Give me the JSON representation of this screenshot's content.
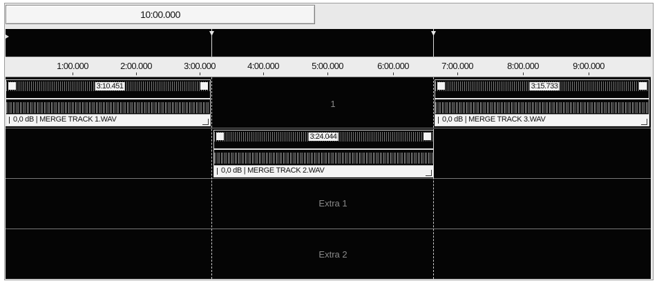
{
  "project": {
    "length": "10:00.000"
  },
  "ruler": {
    "ticks": [
      "1:00.000",
      "2:00.000",
      "3:00.000",
      "4:00.000",
      "5:00.000",
      "6:00.000",
      "7:00.000",
      "8:00.000",
      "9:00.000"
    ]
  },
  "tracks": [
    {
      "name": "1"
    },
    {
      "name": ""
    },
    {
      "name": "Extra 1"
    },
    {
      "name": "Extra 2"
    }
  ],
  "clips": [
    {
      "track": 1,
      "length": "3:10.451",
      "gain_label": "0,0 dB | MERGE TRACK 1.WAV"
    },
    {
      "track": 2,
      "length": "3:24.044",
      "gain_label": "0,0 dB | MERGE TRACK 2.WAV"
    },
    {
      "track": 1,
      "length": "3:15.733",
      "gain_label": "0,0 dB | MERGE TRACK 3.WAV"
    }
  ],
  "colors": {
    "track_background": "#050505",
    "ruler_background": "#ececec",
    "clip_footer": "#f4f4f4"
  }
}
